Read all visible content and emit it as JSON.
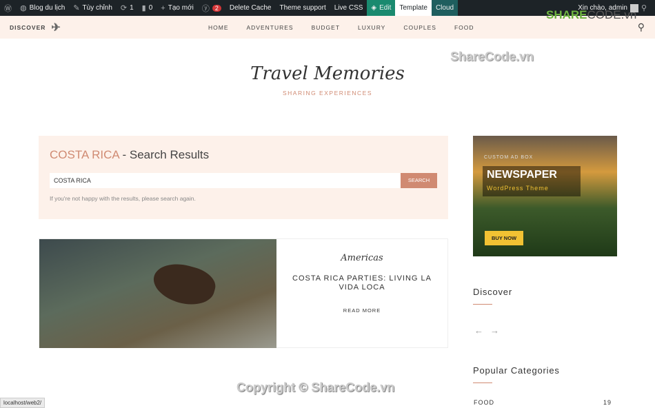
{
  "adminbar": {
    "site": "Blog du lịch",
    "customize": "Tùy chỉnh",
    "updates": "1",
    "comments": "0",
    "new": "Tạo mới",
    "yoast_count": "2",
    "delete_cache": "Delete Cache",
    "theme_support": "Theme support",
    "live_css": "Live CSS",
    "edit": "Edit",
    "template": "Template",
    "cloud": "Cloud",
    "greeting": "Xin chào, admin"
  },
  "nav": {
    "brand": "DISCOVER",
    "items": [
      "HOME",
      "ADVENTURES",
      "BUDGET",
      "LUXURY",
      "COUPLES",
      "FOOD"
    ]
  },
  "logo": {
    "title": "Travel Memories",
    "subtitle": "SHARING EXPERIENCES"
  },
  "watermark": {
    "top": "ShareCode.vn",
    "logo_a": "SHARE",
    "logo_b": "CODE.vn",
    "copyright": "Copyright © ShareCode.vn"
  },
  "search": {
    "keyword": "COSTA RICA",
    "suffix": " - Search Results",
    "value": "COSTA RICA",
    "button": "SEARCH",
    "hint": "If you're not happy with the results, please search again."
  },
  "post": {
    "category": "Americas",
    "title": "COSTA RICA PARTIES: LIVING LA VIDA LOCA",
    "read_more": "READ MORE"
  },
  "ad": {
    "label": "CUSTOM AD BOX",
    "title": "NEWSPAPER",
    "subtitle": "WordPress Theme",
    "button": "BUY NOW"
  },
  "sidebar": {
    "discover": "Discover",
    "popular": "Popular Categories",
    "categories": [
      {
        "name": "FOOD",
        "count": "19"
      }
    ]
  },
  "status": "localhost/web2/"
}
